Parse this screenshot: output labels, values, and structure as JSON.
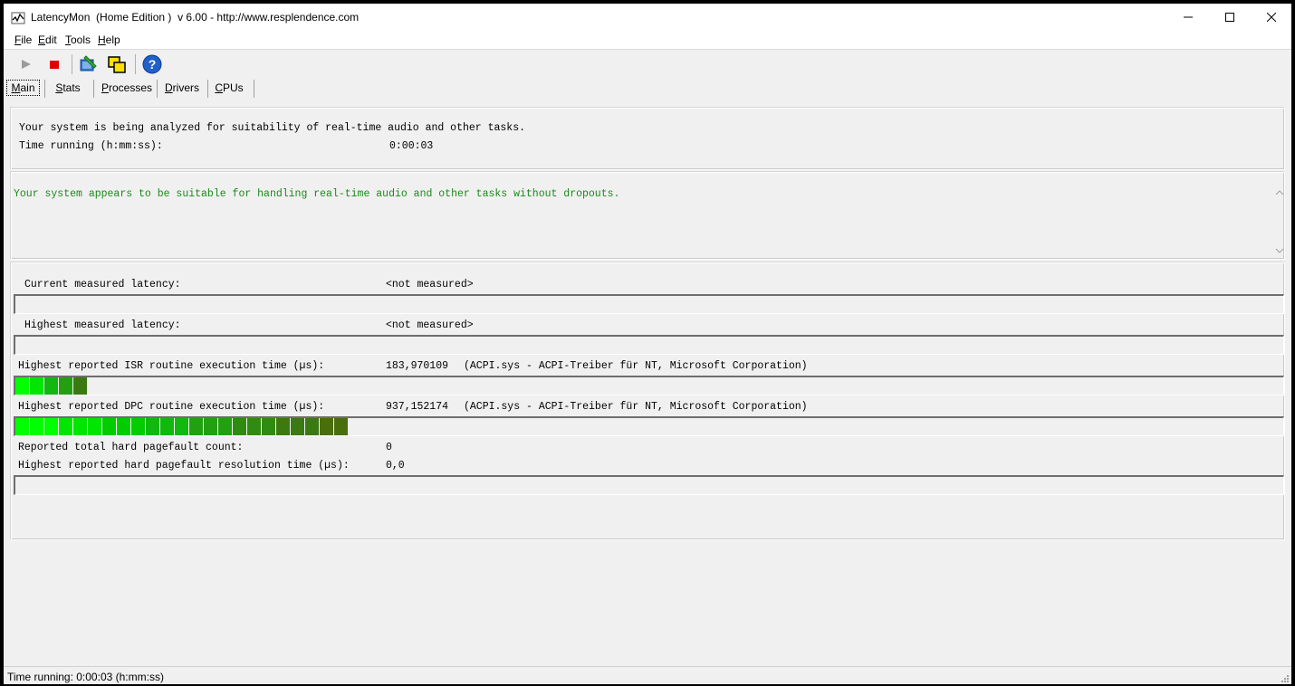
{
  "window": {
    "title": "LatencyMon  (Home Edition )  v 6.00 - http://www.resplendence.com"
  },
  "menu": {
    "items": [
      "File",
      "Edit",
      "Tools",
      "Help"
    ]
  },
  "tabs": [
    "Main",
    "Stats",
    "Processes",
    "Drivers",
    "CPUs"
  ],
  "status_panel": {
    "analysis_text": "Your system is being analyzed for suitability of real-time audio and other tasks.",
    "time_label": "Time running (h:mm:ss):",
    "time_value": "0:00:03"
  },
  "conclusion": {
    "text": "Your system appears to be suitable for handling real-time audio and other tasks without dropouts."
  },
  "metrics": {
    "current_label": "Current measured latency:",
    "current_value": "<not measured>",
    "highest_label": "Highest measured latency:",
    "highest_value": "<not measured>",
    "isr_label": "Highest reported ISR routine execution time (µs):",
    "isr_value": "183,970109",
    "isr_driver": "(ACPI.sys - ACPI-Treiber für NT, Microsoft Corporation)",
    "dpc_label": "Highest reported DPC routine execution time (µs):",
    "dpc_value": "937,152174",
    "dpc_driver": "(ACPI.sys - ACPI-Treiber für NT, Microsoft Corporation)",
    "pagefault_count_label": "Reported total hard pagefault count:",
    "pagefault_count_value": "0",
    "pagefault_time_label": "Highest reported hard pagefault resolution time (µs):",
    "pagefault_time_value": "0,0"
  },
  "bars": {
    "isr_segments": 5,
    "dpc_segments": 23,
    "colors": [
      "#00ff00",
      "#00e600",
      "#00cc00",
      "#10b810",
      "#22a012",
      "#2f8c12",
      "#3a7a10",
      "#4a6e0c"
    ]
  },
  "statusbar": {
    "text": "Time running: 0:00:03  (h:mm:ss)"
  }
}
